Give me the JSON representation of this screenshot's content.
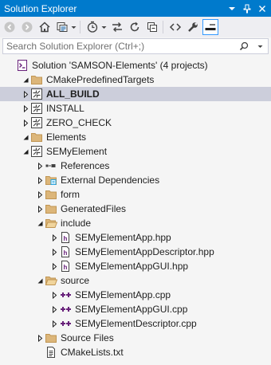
{
  "window": {
    "title": "Solution Explorer",
    "accent_color": "#007acc",
    "selected_row_color": "#cccedb"
  },
  "search": {
    "placeholder": "Search Solution Explorer (Ctrl+;)",
    "value": ""
  },
  "toolbar": {
    "icons": [
      "back-arrow-icon",
      "forward-arrow-icon",
      "home-icon",
      "switch-views-icon",
      "pending-changes-filter-icon",
      "sync-with-active-document-icon",
      "refresh-icon",
      "collapse-all-icon",
      "show-all-files-icon",
      "view-code-icon",
      "properties-icon",
      "preview-selected-items-icon"
    ]
  },
  "tree": [
    {
      "label": "Solution 'SAMSON-Elements' (4 projects)",
      "icon": "solution-icon",
      "expander": "none",
      "depth": 0
    },
    {
      "label": "CMakePredefinedTargets",
      "icon": "folder-icon",
      "expander": "expanded",
      "depth": 1
    },
    {
      "label": "ALL_BUILD",
      "icon": "cmake-target-icon",
      "expander": "collapsed",
      "depth": 2,
      "selected": true,
      "bold": true
    },
    {
      "label": "INSTALL",
      "icon": "cmake-target-icon",
      "expander": "collapsed",
      "depth": 2
    },
    {
      "label": "ZERO_CHECK",
      "icon": "cmake-target-icon",
      "expander": "collapsed",
      "depth": 2
    },
    {
      "label": "Elements",
      "icon": "folder-icon",
      "expander": "expanded",
      "depth": 1
    },
    {
      "label": "SEMyElement",
      "icon": "cmake-target-icon",
      "expander": "expanded",
      "depth": 2
    },
    {
      "label": "References",
      "icon": "references-icon",
      "expander": "collapsed",
      "depth": 3
    },
    {
      "label": "External Dependencies",
      "icon": "external-dependencies-icon",
      "expander": "collapsed",
      "depth": 3
    },
    {
      "label": "form",
      "icon": "folder-icon",
      "expander": "collapsed",
      "depth": 3
    },
    {
      "label": "GeneratedFiles",
      "icon": "folder-icon",
      "expander": "collapsed",
      "depth": 3
    },
    {
      "label": "include",
      "icon": "folder-open-icon",
      "expander": "expanded",
      "depth": 3
    },
    {
      "label": "SEMyElementApp.hpp",
      "icon": "header-file-icon",
      "expander": "collapsed",
      "depth": 4
    },
    {
      "label": "SEMyElementAppDescriptor.hpp",
      "icon": "header-file-icon",
      "expander": "collapsed",
      "depth": 4
    },
    {
      "label": "SEMyElementAppGUI.hpp",
      "icon": "header-file-icon",
      "expander": "collapsed",
      "depth": 4
    },
    {
      "label": "source",
      "icon": "folder-open-icon",
      "expander": "expanded",
      "depth": 3
    },
    {
      "label": "SEMyElementApp.cpp",
      "icon": "cpp-file-icon",
      "expander": "collapsed",
      "depth": 4
    },
    {
      "label": "SEMyElementAppGUI.cpp",
      "icon": "cpp-file-icon",
      "expander": "collapsed",
      "depth": 4
    },
    {
      "label": "SEMyElementDescriptor.cpp",
      "icon": "cpp-file-icon",
      "expander": "collapsed",
      "depth": 4
    },
    {
      "label": "Source Files",
      "icon": "folder-icon",
      "expander": "collapsed",
      "depth": 3
    },
    {
      "label": "CMakeLists.txt",
      "icon": "text-file-icon",
      "expander": "none",
      "depth": 3
    }
  ]
}
